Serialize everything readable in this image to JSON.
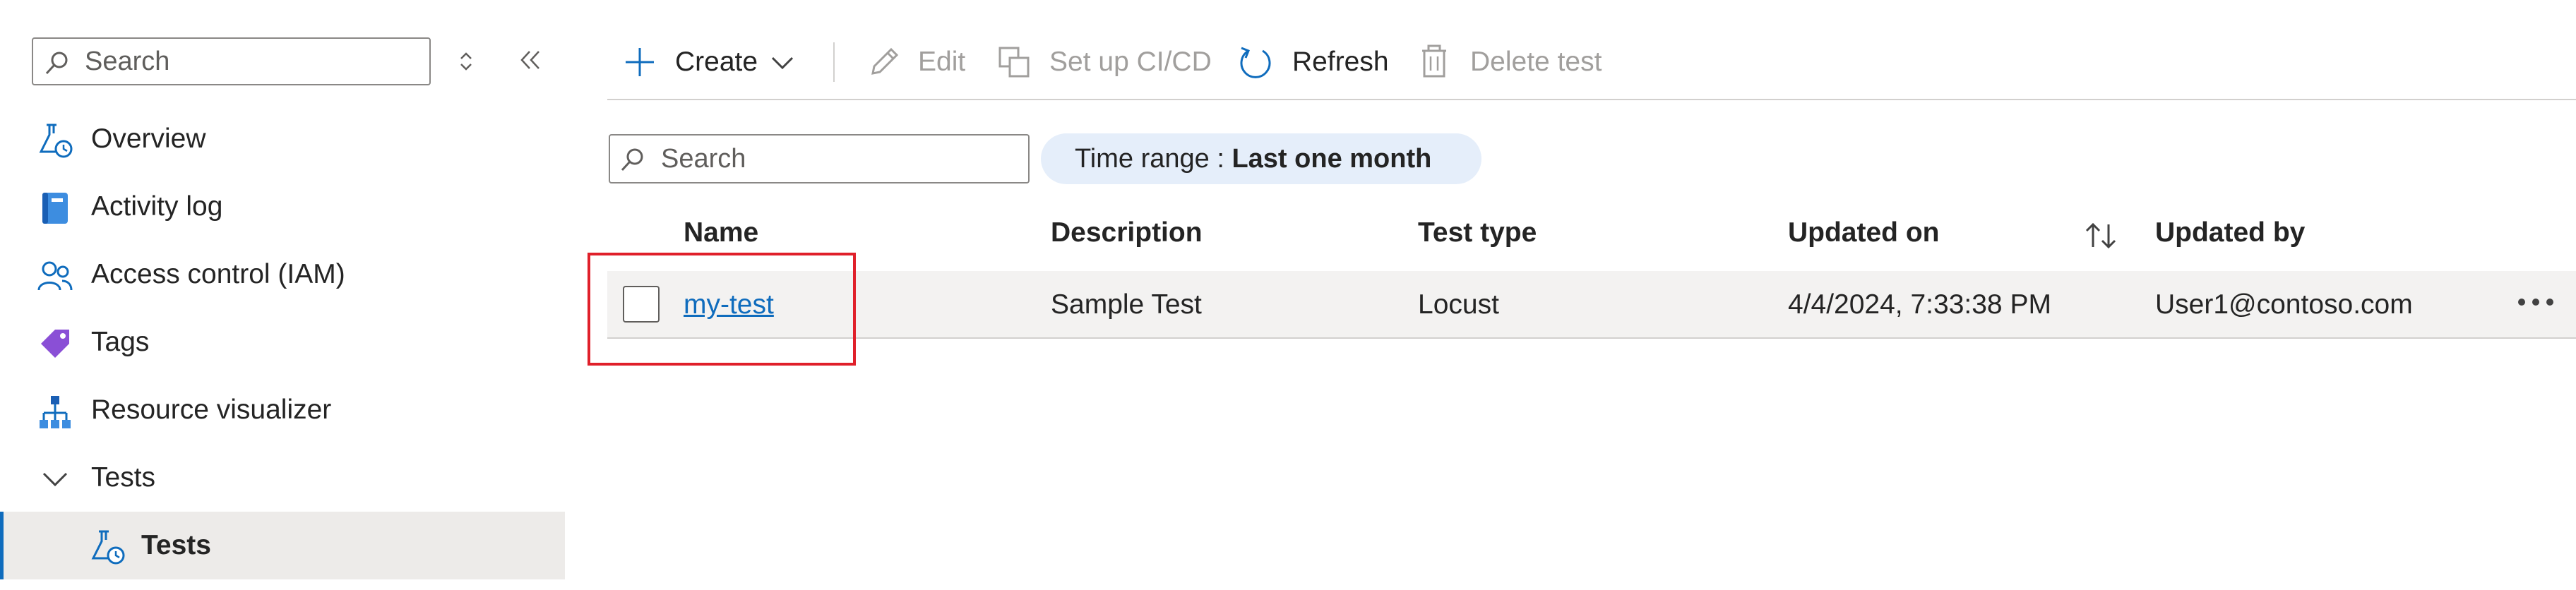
{
  "sidebar": {
    "search_placeholder": "Search",
    "items": [
      {
        "label": "Overview",
        "icon": "flask-clock-icon"
      },
      {
        "label": "Activity log",
        "icon": "book-icon"
      },
      {
        "label": "Access control (IAM)",
        "icon": "people-icon"
      },
      {
        "label": "Tags",
        "icon": "tag-icon"
      },
      {
        "label": "Resource visualizer",
        "icon": "hierarchy-icon"
      },
      {
        "label": "Tests",
        "icon": "chevron-down-icon"
      },
      {
        "label": "Tests",
        "icon": "flask-clock-icon",
        "selected": true
      }
    ]
  },
  "toolbar": {
    "create": "Create",
    "edit": "Edit",
    "setup_cicd": "Set up CI/CD",
    "refresh": "Refresh",
    "delete": "Delete test"
  },
  "filter": {
    "search_placeholder": "Search",
    "time_range_label": "Time range : ",
    "time_range_value": "Last one month"
  },
  "table": {
    "columns": [
      "Name",
      "Description",
      "Test type",
      "Updated on",
      "Updated by"
    ],
    "rows": [
      {
        "name": "my-test",
        "description": "Sample Test",
        "test_type": "Locust",
        "updated_on": "4/4/2024, 7:33:38 PM",
        "updated_by": "User1@contoso.com"
      }
    ]
  },
  "colors": {
    "accent": "#0f6cbd",
    "highlight": "#e0202a",
    "pill": "#e5eefa",
    "selected": "#edebe9"
  }
}
